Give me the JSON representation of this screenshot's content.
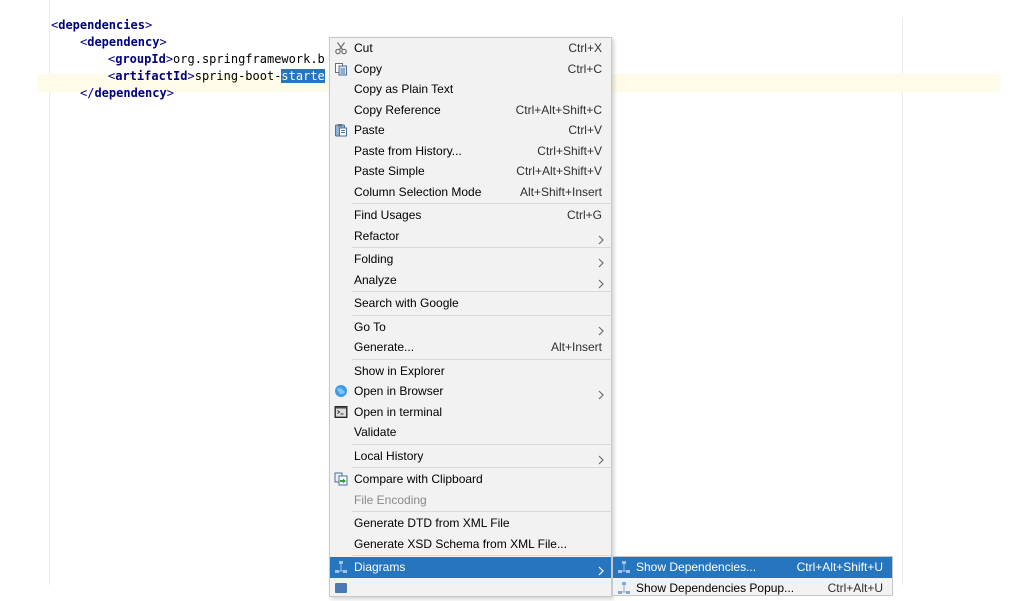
{
  "editor": {
    "lines": [
      {
        "open": "<",
        "tag": "dependencies",
        "close": ">"
      },
      {
        "open": "<",
        "tag": "dependency",
        "close": ">"
      },
      {
        "open": "<",
        "tag": "groupId",
        "close": ">",
        "text": "org.springframework.b"
      },
      {
        "open": "<",
        "tag": "artifactId",
        "close": ">",
        "text": "spring-boot-",
        "selected": "starte"
      },
      {
        "open": "</",
        "tag": "dependency",
        "close": ">"
      }
    ]
  },
  "menu": {
    "items": [
      {
        "label": "Cut",
        "mnemonic": "t",
        "shortcut": "Ctrl+X",
        "icon": "scissors-icon"
      },
      {
        "label": "Copy",
        "mnemonic": "C",
        "shortcut": "Ctrl+C",
        "icon": "copy-icon"
      },
      {
        "label": "Copy as Plain Text"
      },
      {
        "label": "Copy Reference",
        "shortcut": "Ctrl+Alt+Shift+C"
      },
      {
        "label": "Paste",
        "mnemonic": "P",
        "shortcut": "Ctrl+V",
        "icon": "paste-icon"
      },
      {
        "label": "Paste from History...",
        "shortcut": "Ctrl+Shift+V"
      },
      {
        "label": "Paste Simple",
        "shortcut": "Ctrl+Alt+Shift+V"
      },
      {
        "label": "Column Selection Mode",
        "shortcut": "Alt+Shift+Insert"
      },
      {
        "separator": true
      },
      {
        "label": "Find Usages",
        "shortcut": "Ctrl+G"
      },
      {
        "label": "Refactor",
        "submenu": true
      },
      {
        "separator": true
      },
      {
        "label": "Folding",
        "submenu": true
      },
      {
        "label": "Analyze",
        "submenu": true
      },
      {
        "separator": true
      },
      {
        "label": "Search with Google"
      },
      {
        "separator": true
      },
      {
        "label": "Go To",
        "submenu": true
      },
      {
        "label": "Generate...",
        "shortcut": "Alt+Insert"
      },
      {
        "separator": true
      },
      {
        "label": "Show in Explorer"
      },
      {
        "label": "Open in Browser",
        "submenu": true,
        "icon": "globe-icon"
      },
      {
        "label": "Open in terminal",
        "icon": "terminal-icon"
      },
      {
        "label": "Validate"
      },
      {
        "separator": true
      },
      {
        "label": "Local History",
        "submenu": true
      },
      {
        "separator": true
      },
      {
        "label": "Compare with Clipboard",
        "icon": "compare-icon"
      },
      {
        "label": "File Encoding",
        "disabled": true
      },
      {
        "separator": true
      },
      {
        "label": "Generate DTD from XML File"
      },
      {
        "label": "Generate XSD Schema from XML File..."
      },
      {
        "separator": true
      },
      {
        "label": "Diagrams",
        "submenu": true,
        "highlighted": true,
        "icon": "diagram-icon"
      },
      {
        "label": "",
        "icon": "maven-icon"
      }
    ]
  },
  "submenu": {
    "items": [
      {
        "label": "Show Dependencies...",
        "shortcut": "Ctrl+Alt+Shift+U",
        "highlighted": true,
        "icon": "diagram-icon"
      },
      {
        "label": "Show Dependencies Popup...",
        "shortcut": "Ctrl+Alt+U",
        "icon": "diagram-icon"
      }
    ]
  },
  "colors": {
    "accent": "#2675bf",
    "menu_bg": "#f2f2f2",
    "tag": "#000080",
    "current_line": "#fefbe8"
  }
}
